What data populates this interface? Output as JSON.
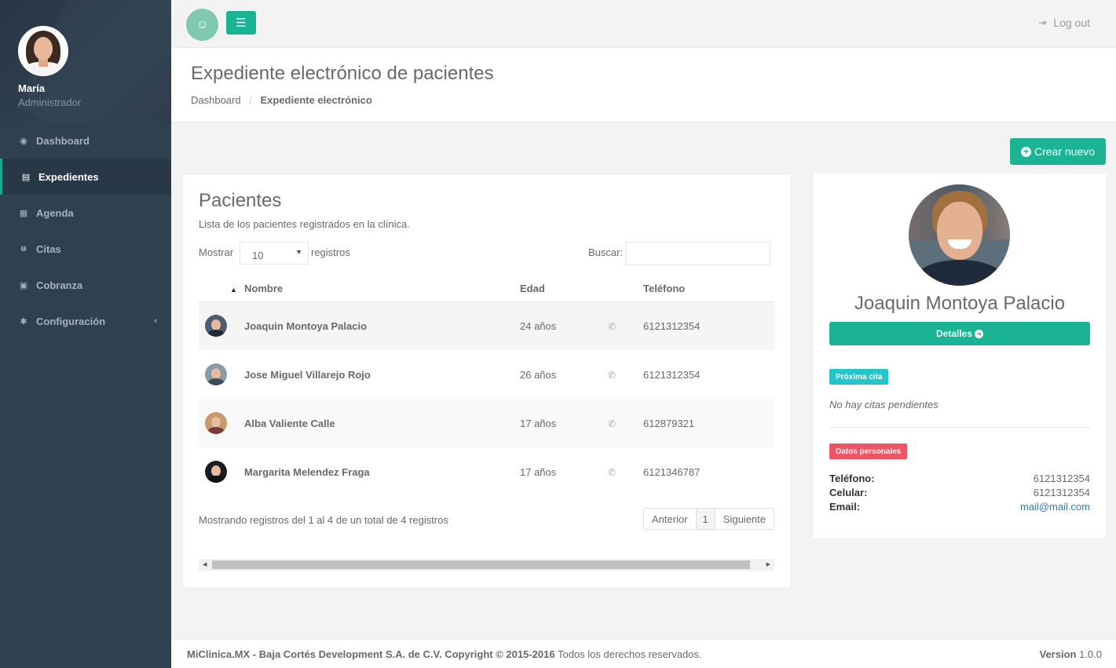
{
  "user": {
    "name": "María",
    "role": "Administrador"
  },
  "sidebar": {
    "items": [
      {
        "label": "Dashboard",
        "icon": "dashboard-icon"
      },
      {
        "label": "Expedientes",
        "icon": "file-icon",
        "active": true
      },
      {
        "label": "Agenda",
        "icon": "calendar-icon"
      },
      {
        "label": "Citas",
        "icon": "stethoscope-icon"
      },
      {
        "label": "Cobranza",
        "icon": "money-icon"
      },
      {
        "label": "Configuración",
        "icon": "gear-icon"
      }
    ]
  },
  "topbar": {
    "logout_label": "Log out"
  },
  "heading": {
    "title": "Expediente electrónico de pacientes",
    "breadcrumb": {
      "home": "Dashboard",
      "current": "Expediente electrónico"
    }
  },
  "actions": {
    "new_label": "Crear nuevo"
  },
  "patients": {
    "title": "Pacientes",
    "subtitle": "Lista de los pacientes registrados en la clínica.",
    "show_label": "Mostrar",
    "show_value": "10",
    "records_label": "registros",
    "search_label": "Buscar:",
    "columns": {
      "name": "Nombre",
      "age": "Edad",
      "phone": "Teléfono"
    },
    "rows": [
      {
        "name": "Joaquin Montoya Palacio",
        "age": "24 años",
        "phone": "6121312354"
      },
      {
        "name": "Jose Miguel Villarejo Rojo",
        "age": "26 años",
        "phone": "6121312354"
      },
      {
        "name": "Alba Valiente Calle",
        "age": "17 años",
        "phone": "612879321"
      },
      {
        "name": "Margarita Melendez Fraga",
        "age": "17 años",
        "phone": "6121346787"
      }
    ],
    "info": "Mostrando registros del 1 al 4 de un total de 4 registros",
    "pager": {
      "prev": "Anterior",
      "page": "1",
      "next": "Siguiente"
    }
  },
  "profile": {
    "name": "Joaquin Montoya Palacio",
    "details_label": "Detalles",
    "next_badge": "Próxima cita",
    "no_appointments": "No hay citas pendientes",
    "personal_badge": "Datos personales",
    "phone_label": "Teléfono:",
    "phone": "6121312354",
    "cell_label": "Celular:",
    "cell": "6121312354",
    "email_label": "Email:",
    "email": "mail@mail.com"
  },
  "footer": {
    "brand": "MiClinica.MX - Baja Cortés Development S.A. de C.V. Copyright © 2015-2016",
    "rights": "Todos los derechos reservados.",
    "version_label": "Version",
    "version": "1.0.0"
  },
  "colors": {
    "primary": "#1ab394",
    "sidebar": "#2f4050",
    "info": "#23c6c8",
    "danger": "#ed5565"
  }
}
